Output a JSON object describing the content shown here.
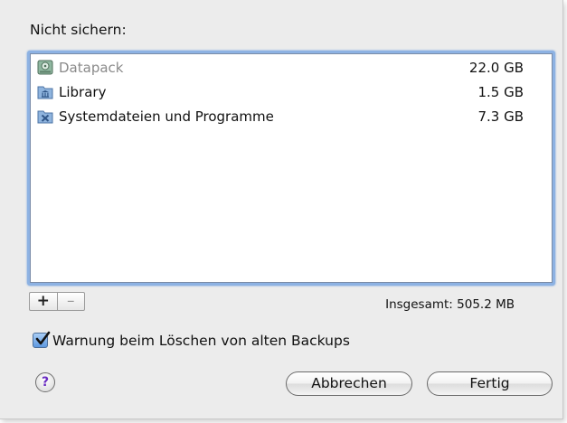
{
  "dialog": {
    "heading": "Nicht sichern:",
    "items": [
      {
        "name": "Datapack",
        "size": "22.0 GB",
        "icon": "external-drive-icon",
        "dimmed": true
      },
      {
        "name": "Library",
        "size": "1.5 GB",
        "icon": "library-folder-icon",
        "dimmed": false
      },
      {
        "name": "Systemdateien und Programme",
        "size": "7.3 GB",
        "icon": "system-folder-icon",
        "dimmed": false
      }
    ],
    "add_label": "+",
    "remove_label": "–",
    "total": "Insgesamt: 505.2 MB",
    "warning_checkbox": {
      "label": "Warnung beim Löschen von alten Backups",
      "checked": true
    },
    "help_label": "?",
    "cancel_label": "Abbrechen",
    "done_label": "Fertig"
  },
  "colors": {
    "background": "#ececec",
    "focus_ring": "#8db2e3",
    "check_fill": "#5e98e0",
    "help_mark": "#6a2cc2"
  }
}
